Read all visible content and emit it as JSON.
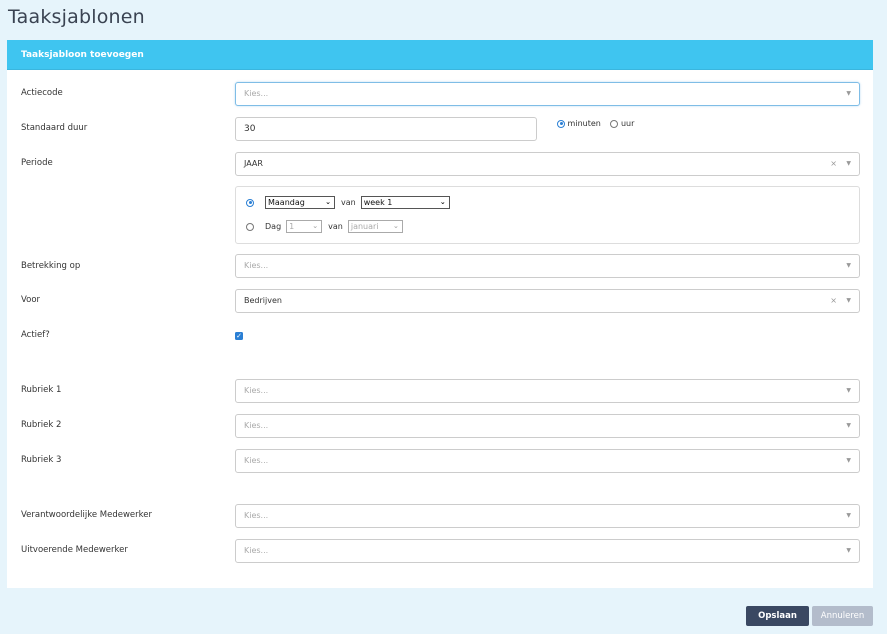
{
  "page": {
    "title": "Taaksjablonen"
  },
  "panel": {
    "header": "Taaksjabloon toevoegen"
  },
  "form": {
    "actiecode": {
      "label": "Actiecode",
      "placeholder": "Kies..."
    },
    "standaard_duur": {
      "label": "Standaard duur",
      "value": "30",
      "unit_minutes": "minuten",
      "unit_hours": "uur",
      "selected_unit": "minuten"
    },
    "periode": {
      "label": "Periode",
      "value": "JAAR",
      "clear": "×"
    },
    "period_options": {
      "row1_day": "Maandag",
      "row1_van": "van",
      "row1_week": "week 1",
      "row2_label": "Dag",
      "row2_day": "1",
      "row2_van": "van",
      "row2_month": "januari"
    },
    "betrekking_op": {
      "label": "Betrekking op",
      "placeholder": "Kies..."
    },
    "voor": {
      "label": "Voor",
      "value": "Bedrijven",
      "clear": "×"
    },
    "actief": {
      "label": "Actief?",
      "checked": true
    },
    "rubriek1": {
      "label": "Rubriek 1",
      "placeholder": "Kies..."
    },
    "rubriek2": {
      "label": "Rubriek 2",
      "placeholder": "Kies..."
    },
    "rubriek3": {
      "label": "Rubriek 3",
      "placeholder": "Kies..."
    },
    "verantwoordelijke": {
      "label": "Verantwoordelijke Medewerker",
      "placeholder": "Kies..."
    },
    "uitvoerende": {
      "label": "Uitvoerende Medewerker",
      "placeholder": "Kies..."
    }
  },
  "buttons": {
    "save": "Opslaan",
    "cancel": "Annuleren"
  },
  "icons": {
    "dropdown": "chevron-down-icon",
    "clear": "clear-icon",
    "check": "checkmark-icon"
  },
  "colors": {
    "header": "#3fc5f0",
    "save": "#3a4862",
    "cancel": "#b3bccb",
    "accent": "#2a7fd4"
  }
}
